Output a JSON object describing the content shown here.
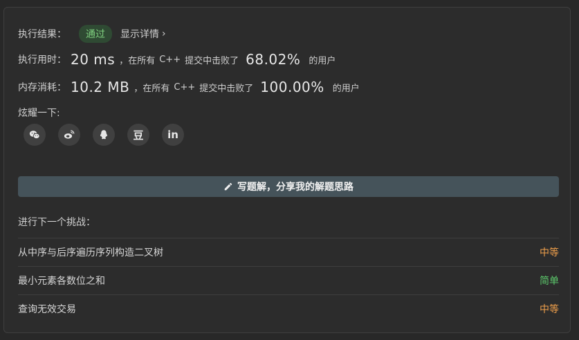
{
  "result": {
    "label": "执行结果：",
    "status": "通过",
    "details_label": "显示详情",
    "details_chevron": "›"
  },
  "runtime": {
    "label": "执行用时：",
    "value": "20 ms",
    "prefix": "，在所有",
    "lang": "C++",
    "middle": "提交中击败了",
    "percent": "68.02%",
    "suffix": "的用户"
  },
  "memory": {
    "label": "内存消耗：",
    "value": "10.2 MB",
    "prefix": "，在所有",
    "lang": "C++",
    "middle": "提交中击败了",
    "percent": "100.00%",
    "suffix": "的用户"
  },
  "share": {
    "label": "炫耀一下:",
    "icons": [
      "wechat-icon",
      "weibo-icon",
      "qq-icon",
      "douban-icon",
      "linkedin-icon"
    ],
    "douban_text": "豆",
    "linkedin_text": "in"
  },
  "write_solution": {
    "label": "写题解，分享我的解题思路",
    "icon": "pencil-icon"
  },
  "next_challenge": {
    "title": "进行下一个挑战：",
    "items": [
      {
        "title": "从中序与后序遍历序列构造二叉树",
        "difficulty": "中等",
        "level": "medium"
      },
      {
        "title": "最小元素各数位之和",
        "difficulty": "简单",
        "level": "easy"
      },
      {
        "title": "查询无效交易",
        "difficulty": "中等",
        "level": "medium"
      }
    ]
  },
  "colors": {
    "background": "#2c2c2c",
    "pass_badge": "#2f4a33",
    "medium": "#f0a04b",
    "easy": "#5cc96b",
    "button": "#45535a"
  }
}
